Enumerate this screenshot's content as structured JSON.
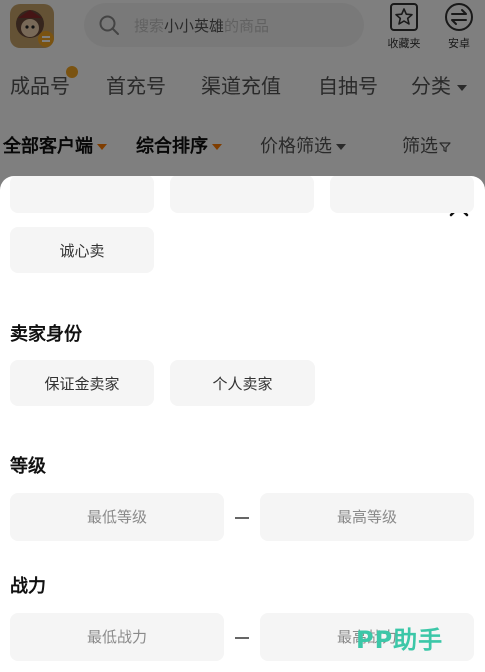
{
  "search": {
    "placeholder_prefix": "搜索",
    "game_name": "小小英雄",
    "placeholder_suffix": "的商品"
  },
  "header_actions": {
    "favorites_label": "收藏夹",
    "platform_label": "安卓"
  },
  "category_tabs": [
    "成品号",
    "首充号",
    "渠道充值",
    "自抽号",
    "分类"
  ],
  "sort_bar": {
    "client": "全部客户端",
    "sort": "综合排序",
    "price": "价格筛选",
    "filter": "筛选"
  },
  "filter_sheet": {
    "trade_options": [
      "诚心卖"
    ],
    "seller_section": {
      "title": "卖家身份",
      "options": [
        "保证金卖家",
        "个人卖家"
      ]
    },
    "level_section": {
      "title": "等级",
      "min_placeholder": "最低等级",
      "max_placeholder": "最高等级"
    },
    "power_section": {
      "title": "战力",
      "min_placeholder": "最低战力",
      "max_placeholder": "最高战力"
    }
  },
  "watermark": "PP助手",
  "colors": {
    "accent_orange": "#ff7a00",
    "badge_yellow": "#f5a623",
    "watermark_green": "#3cc7a8",
    "chip_bg": "#f5f5f5"
  },
  "icons": [
    "game-avatar-icon",
    "search-icon",
    "star-folder-icon",
    "android-swap-icon",
    "filter-icon",
    "close-icon"
  ]
}
